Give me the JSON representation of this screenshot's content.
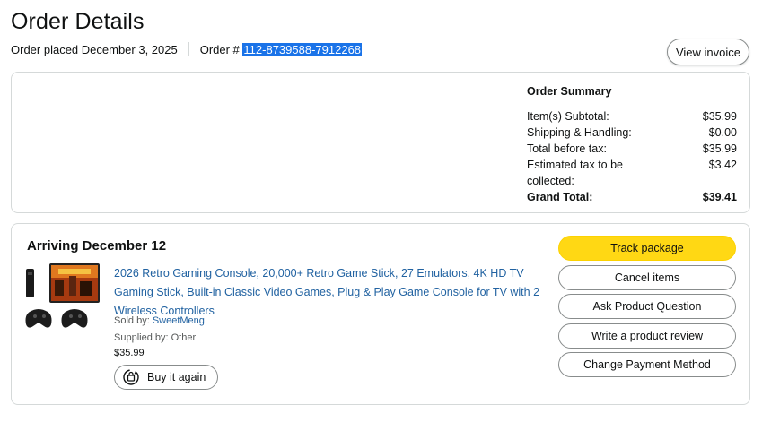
{
  "header": {
    "title": "Order Details",
    "order_placed": "Order placed December 3, 2025",
    "order_label": "Order #",
    "order_number": "112-8739588-7912268",
    "view_invoice": "View invoice"
  },
  "summary": {
    "title": "Order Summary",
    "rows": [
      {
        "label": "Item(s) Subtotal:",
        "value": "$35.99"
      },
      {
        "label": "Shipping & Handling:",
        "value": "$0.00"
      },
      {
        "label": "Total before tax:",
        "value": "$35.99"
      },
      {
        "label": "Estimated tax to be collected:",
        "value": "$3.42"
      }
    ],
    "total_label": "Grand Total:",
    "total_value": "$39.41"
  },
  "shipment": {
    "arriving": "Arriving December 12",
    "product_title": "2026 Retro Gaming Console, 20,000+ Retro Game Stick, 27 Emulators, 4K HD TV Gaming Stick, Built-in Classic Video Games, Plug & Play Game Console for TV with 2 Wireless Controllers",
    "sold_by_label": "Sold by: ",
    "seller": "SweetMeng",
    "supplied_by": "Supplied by: Other",
    "price": "$35.99",
    "buy_again": "Buy it again"
  },
  "actions": {
    "track": "Track package",
    "cancel": "Cancel items",
    "ask": "Ask Product Question",
    "review": "Write a product review",
    "payment": "Change Payment Method"
  },
  "colors": {
    "primary_button": "#ffd814",
    "link": "#2162a1",
    "highlight": "#1a73e8"
  }
}
